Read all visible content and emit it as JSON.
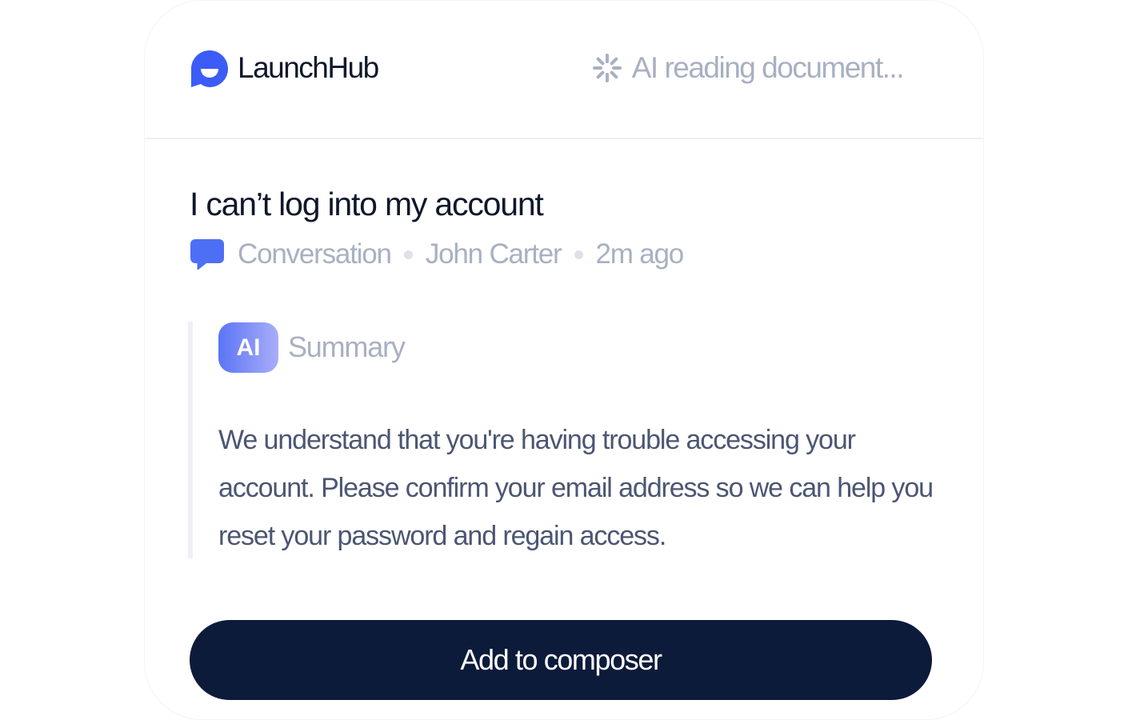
{
  "header": {
    "brand": "LaunchHub",
    "status_text": "AI reading document...",
    "brand_color": "#3b5cf6"
  },
  "conversation": {
    "title": "I can’t log into my account",
    "type": "Conversation",
    "author": "John Carter",
    "time": "2m ago"
  },
  "summary": {
    "badge": "AI",
    "label": "Summary",
    "text": "We understand that you're having trouble accessing your account. Please confirm your email address so we can help you reset your password and regain access."
  },
  "actions": {
    "add_label": "Add to composer"
  },
  "icons": {
    "logo": "smiling-chat-bubble-icon",
    "status": "loading-spinner-icon",
    "conversation": "chat-bubble-icon"
  }
}
